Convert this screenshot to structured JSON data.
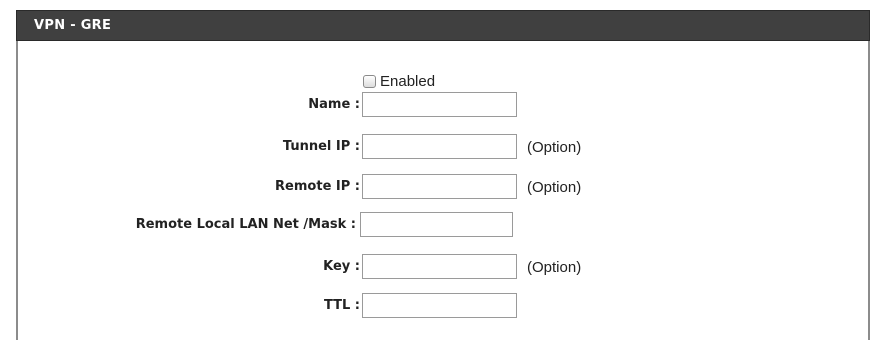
{
  "panel": {
    "title": "VPN - GRE"
  },
  "enable": {
    "label": "Enabled",
    "checked": false
  },
  "fields": [
    {
      "label": "Name :",
      "value": "",
      "hint": ""
    },
    {
      "label": "Tunnel IP :",
      "value": "",
      "hint": "(Option)"
    },
    {
      "label": "Remote IP :",
      "value": "",
      "hint": "(Option)"
    },
    {
      "label": "Remote Local LAN Net /Mask :",
      "value": "",
      "hint": ""
    },
    {
      "label": "Key :",
      "value": "",
      "hint": "(Option)"
    },
    {
      "label": "TTL :",
      "value": "",
      "hint": ""
    }
  ]
}
